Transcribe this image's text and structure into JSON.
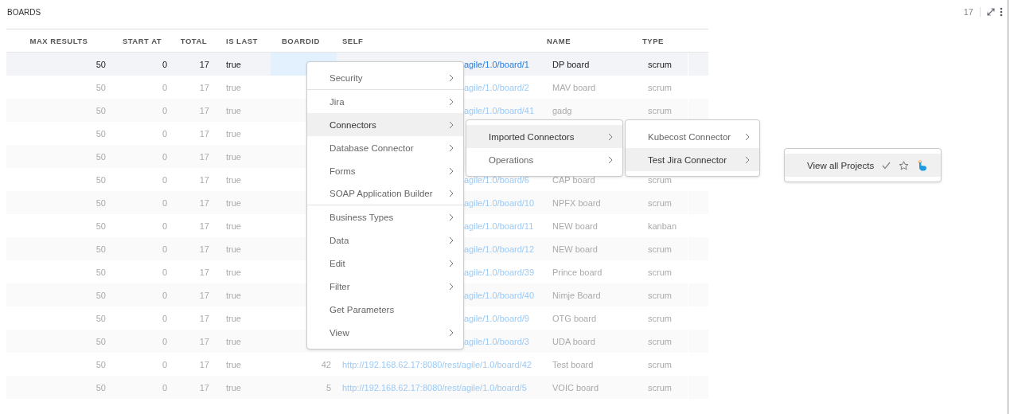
{
  "panel": {
    "title": "BOARDS",
    "count": "17"
  },
  "table": {
    "columns": [
      "MAX RESULTS",
      "START AT",
      "TOTAL",
      "IS LAST",
      "BOARDID",
      "SELF",
      "NAME",
      "TYPE"
    ],
    "rows": [
      {
        "selected": true,
        "max_results": "50",
        "start_at": "0",
        "total": "17",
        "is_last": "true",
        "self": "agile/1.0/board/1",
        "name": "DP board",
        "type": "scrum"
      },
      {
        "selected": false,
        "max_results": "50",
        "start_at": "0",
        "total": "17",
        "is_last": "true",
        "self": "agile/1.0/board/2",
        "name": "MAV board",
        "type": "scrum"
      },
      {
        "selected": false,
        "max_results": "50",
        "start_at": "0",
        "total": "17",
        "is_last": "true",
        "self": "agile/1.0/board/41",
        "name": "gadg",
        "type": "scrum"
      },
      {
        "selected": false,
        "max_results": "50",
        "start_at": "0",
        "total": "17",
        "is_last": "true"
      },
      {
        "selected": false,
        "max_results": "50",
        "start_at": "0",
        "total": "17",
        "is_last": "true"
      },
      {
        "selected": false,
        "max_results": "50",
        "start_at": "0",
        "total": "17",
        "is_last": "true",
        "self": "agile/1.0/board/6",
        "name": "CAP board",
        "type": "scrum"
      },
      {
        "selected": false,
        "max_results": "50",
        "start_at": "0",
        "total": "17",
        "is_last": "true",
        "self": "agile/1.0/board/10",
        "name": "NPFX board",
        "type": "scrum"
      },
      {
        "selected": false,
        "max_results": "50",
        "start_at": "0",
        "total": "17",
        "is_last": "true",
        "self": "agile/1.0/board/11",
        "name": "NEW board",
        "type": "kanban"
      },
      {
        "selected": false,
        "max_results": "50",
        "start_at": "0",
        "total": "17",
        "is_last": "true",
        "self": "agile/1.0/board/12",
        "name": "NEW board",
        "type": "scrum"
      },
      {
        "selected": false,
        "max_results": "50",
        "start_at": "0",
        "total": "17",
        "is_last": "true",
        "self": "agile/1.0/board/39",
        "name": "Prince board",
        "type": "scrum"
      },
      {
        "selected": false,
        "max_results": "50",
        "start_at": "0",
        "total": "17",
        "is_last": "true",
        "self": "agile/1.0/board/40",
        "name": "Nimje Board",
        "type": "scrum"
      },
      {
        "selected": false,
        "max_results": "50",
        "start_at": "0",
        "total": "17",
        "is_last": "true",
        "self": "agile/1.0/board/9",
        "name": "OTG board",
        "type": "scrum"
      },
      {
        "selected": false,
        "max_results": "50",
        "start_at": "0",
        "total": "17",
        "is_last": "true",
        "self": "agile/1.0/board/3",
        "name": "UDA board",
        "type": "scrum"
      },
      {
        "selected": false,
        "max_results": "50",
        "start_at": "0",
        "total": "17",
        "is_last": "true",
        "boardid": "42",
        "self": "http://192.168.62.17:8080/rest/agile/1.0/board/42",
        "name": "Test board",
        "type": "scrum"
      },
      {
        "selected": false,
        "max_results": "50",
        "start_at": "0",
        "total": "17",
        "is_last": "true",
        "boardid": "5",
        "self": "http://192.168.62.17:8080/rest/agile/1.0/board/5",
        "name": "VOIC board",
        "type": "scrum"
      }
    ]
  },
  "menus": [
    {
      "items": [
        {
          "kind": "submenu",
          "label": "Security",
          "selected": false,
          "separator_after": true
        },
        {
          "kind": "submenu",
          "label": "Jira",
          "selected": false,
          "separator_after": false
        },
        {
          "kind": "submenu",
          "label": "Connectors",
          "selected": true,
          "separator_after": false
        },
        {
          "kind": "submenu",
          "label": "Database Connector",
          "selected": false,
          "separator_after": false
        },
        {
          "kind": "submenu",
          "label": "Forms",
          "selected": false,
          "separator_after": false
        },
        {
          "kind": "submenu",
          "label": "SOAP Application Builder",
          "selected": false,
          "separator_after": true
        },
        {
          "kind": "submenu",
          "label": "Business Types",
          "selected": false,
          "separator_after": false
        },
        {
          "kind": "submenu",
          "label": "Data",
          "selected": false,
          "separator_after": false
        },
        {
          "kind": "submenu",
          "label": "Edit",
          "selected": false,
          "separator_after": false
        },
        {
          "kind": "submenu",
          "label": "Filter",
          "selected": false,
          "separator_after": false
        },
        {
          "kind": "plain",
          "label": "Get Parameters",
          "selected": false,
          "separator_after": false
        },
        {
          "kind": "submenu",
          "label": "View",
          "selected": false,
          "separator_after": false
        }
      ]
    },
    {
      "items": [
        {
          "kind": "submenu",
          "label": "Imported Connectors",
          "selected": true,
          "separator_after": false
        },
        {
          "kind": "submenu",
          "label": "Operations",
          "selected": false,
          "separator_after": false
        }
      ]
    },
    {
      "items": [
        {
          "kind": "submenu",
          "label": "Kubecost Connector",
          "selected": false,
          "separator_after": false
        },
        {
          "kind": "submenu",
          "label": "Test Jira Connector",
          "selected": true,
          "separator_after": false
        }
      ]
    },
    {
      "items": [
        {
          "kind": "action",
          "label": "View all Projects",
          "selected": true,
          "separator_after": false
        }
      ]
    }
  ]
}
